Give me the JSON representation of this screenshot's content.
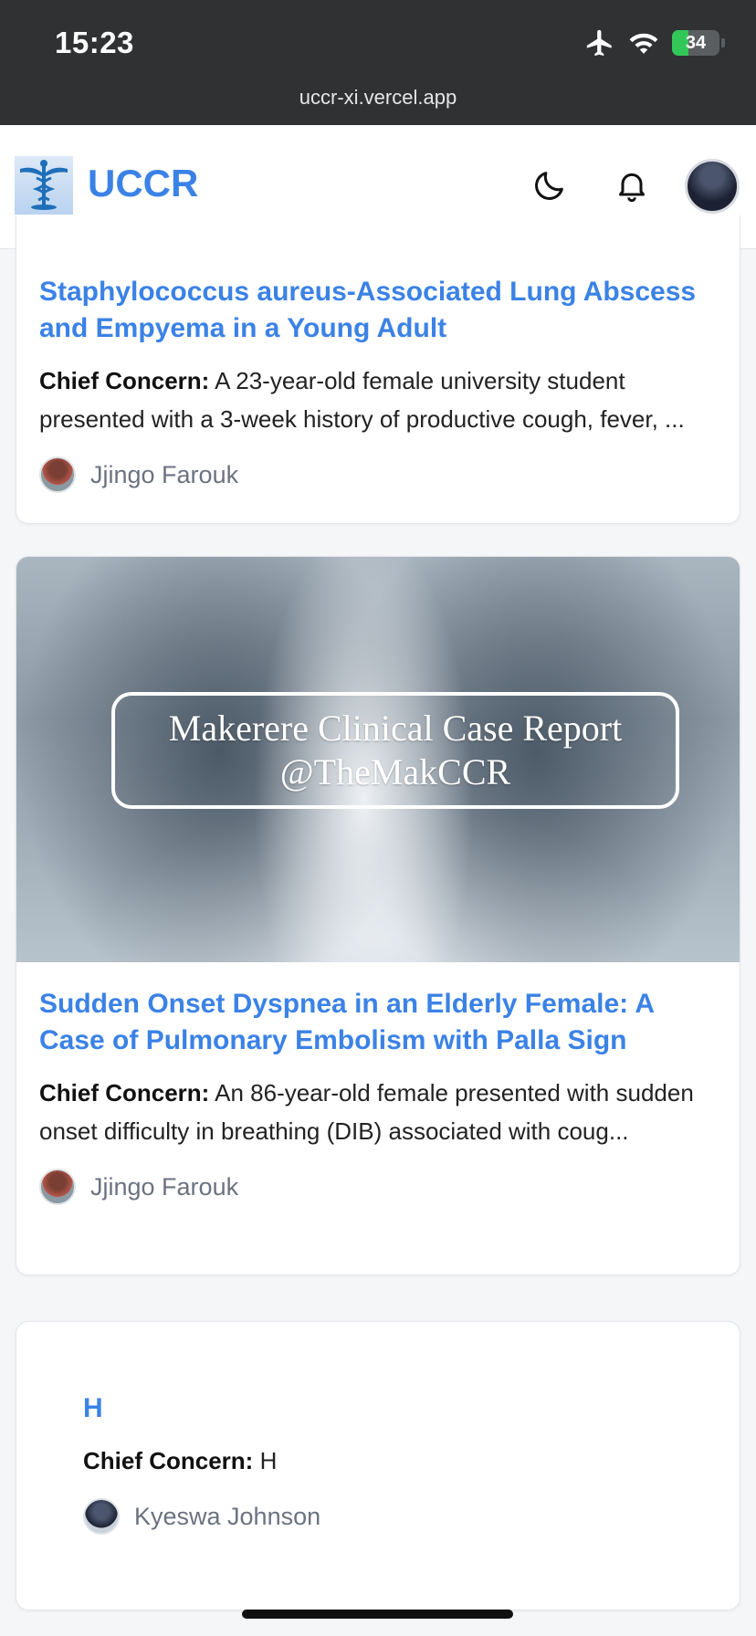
{
  "status_bar": {
    "time": "15:23",
    "battery_level": "34",
    "url": "uccr-xi.vercel.app"
  },
  "app_header": {
    "brand": "UCCR"
  },
  "cards": [
    {
      "title": "Staphylococcus aureus-Associated Lung Abscess and Empyema in a Young Adult",
      "summary_label": "Chief Concern:",
      "summary_text": " A 23-year-old female university student presented with a 3-week history of productive cough, fever, ...",
      "author": "Jjingo Farouk"
    },
    {
      "image_caption_line1": "Makerere Clinical Case Report",
      "image_caption_line2": "@TheMakCCR",
      "title": "Sudden Onset Dyspnea in an Elderly Female: A Case of Pulmonary Embolism with Palla Sign",
      "summary_label": "Chief Concern:",
      "summary_text": " An 86-year-old female presented with sudden onset difficulty in breathing (DIB) associated with coug...",
      "author": "Jjingo Farouk"
    },
    {
      "title": "H",
      "summary_label": "Chief Concern:",
      "summary_text": " H",
      "author": "Kyeswa Johnson"
    }
  ],
  "colors": {
    "accent": "#3b82e6",
    "status_bar_bg": "#2f3133",
    "battery_green": "#33c759"
  },
  "icons": [
    "airplane-icon",
    "wifi-icon",
    "battery-icon",
    "caduceus-logo-icon",
    "moon-icon",
    "bell-icon"
  ]
}
